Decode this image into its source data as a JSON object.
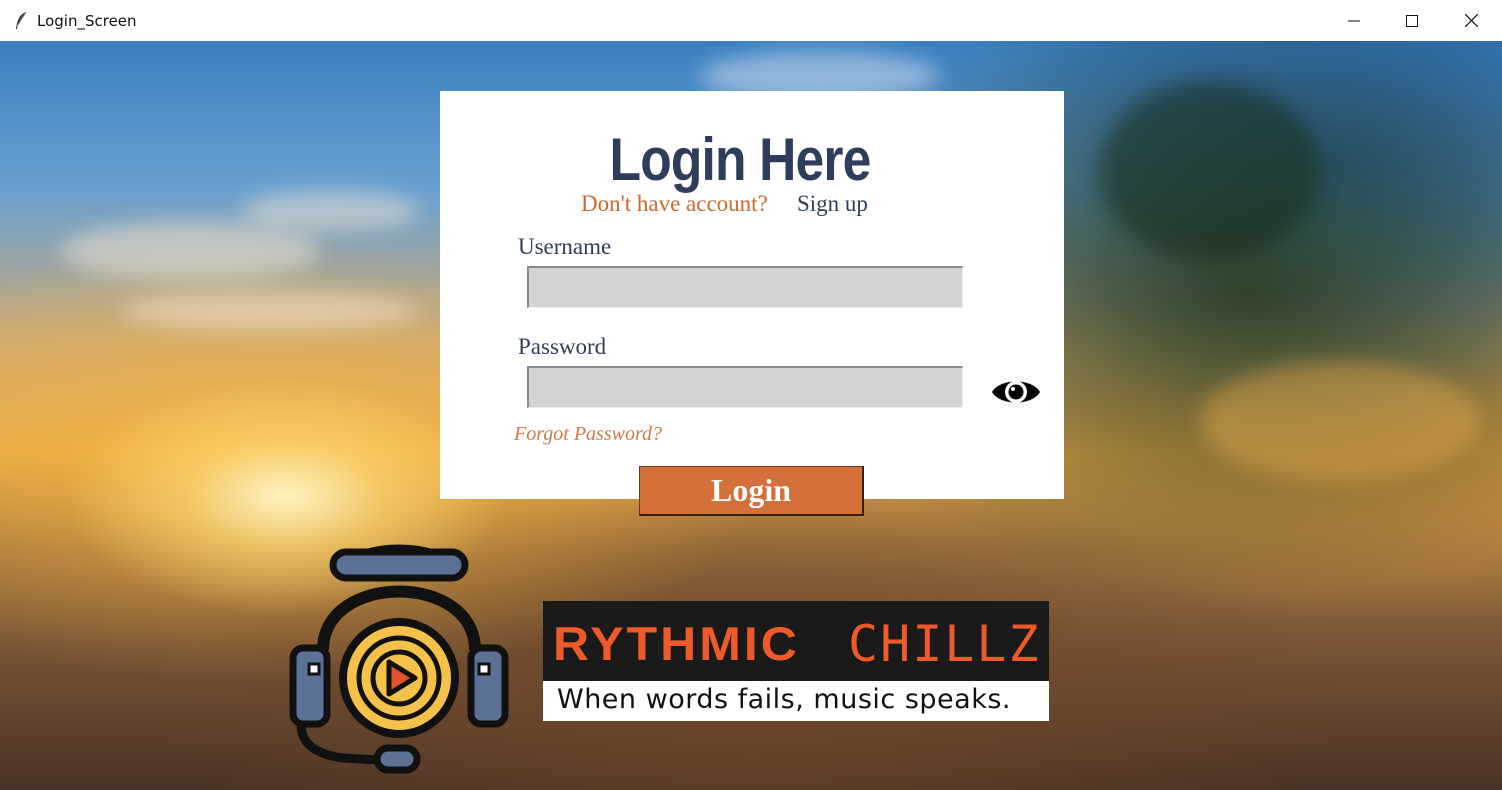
{
  "window": {
    "title": "Login_Screen",
    "controls": [
      "minimize-icon",
      "maximize-icon",
      "close-icon"
    ]
  },
  "login": {
    "heading": "Login Here",
    "no_account_text": "Don't have account?",
    "signup_link": "Sign up",
    "username_label": "Username",
    "username_value": "",
    "password_label": "Password",
    "password_value": "",
    "show_password_icon": "eye-icon",
    "forgot_password": "Forgot Password?",
    "login_button": "Login"
  },
  "brand": {
    "name_part1": "RYTHMIC",
    "name_part2": "CHILLZ",
    "tagline": "When words fails, music speaks.",
    "logo_icon": "headphones-play-icon"
  },
  "colors": {
    "heading": "#2f3d5c",
    "accent": "#d3703a",
    "link_orange": "#c96a2e",
    "input_bg": "#d3d3d3",
    "brand_orange": "#ee5a2a"
  }
}
